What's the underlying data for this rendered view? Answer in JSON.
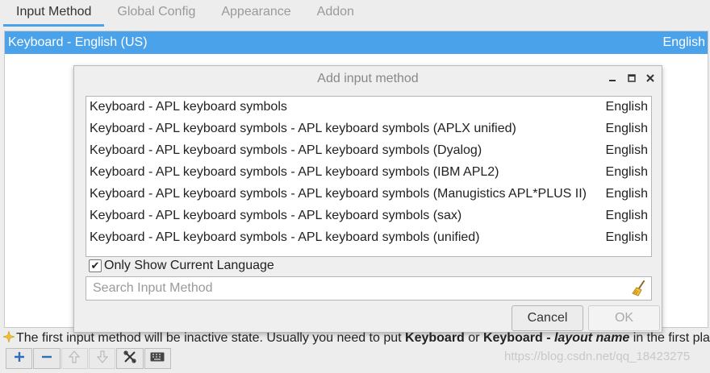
{
  "tabs": [
    {
      "label": "Input Method"
    },
    {
      "label": "Global Config"
    },
    {
      "label": "Appearance"
    },
    {
      "label": "Addon"
    }
  ],
  "main_list": {
    "selected": {
      "name": "Keyboard - English (US)",
      "language": "English"
    }
  },
  "dialog": {
    "title": "Add input method",
    "items": [
      {
        "name": "Keyboard - APL keyboard symbols",
        "language": "English"
      },
      {
        "name": "Keyboard - APL keyboard symbols - APL keyboard symbols (APLX unified)",
        "language": "English"
      },
      {
        "name": "Keyboard - APL keyboard symbols - APL keyboard symbols (Dyalog)",
        "language": "English"
      },
      {
        "name": "Keyboard - APL keyboard symbols - APL keyboard symbols (IBM APL2)",
        "language": "English"
      },
      {
        "name": "Keyboard - APL keyboard symbols - APL keyboard symbols (Manugistics APL*PLUS II)",
        "language": "English"
      },
      {
        "name": "Keyboard - APL keyboard symbols - APL keyboard symbols (sax)",
        "language": "English"
      },
      {
        "name": "Keyboard - APL keyboard symbols - APL keyboard symbols (unified)",
        "language": "English"
      }
    ],
    "only_current_language": {
      "label": "Only Show Current Language",
      "checked": true
    },
    "search": {
      "placeholder": "Search Input Method",
      "value": ""
    },
    "cancel_label": "Cancel",
    "ok_label": "OK"
  },
  "hint": {
    "part1": "The first input method will be inactive state. Usually you need to put ",
    "bold1": "Keyboard",
    "part2": " or ",
    "bold2": "Keyboard - ",
    "bold_italic": "layout name",
    "part3": " in the first place."
  },
  "toolbar": {
    "buttons": [
      "add-icon",
      "remove-icon",
      "move-up-icon",
      "move-down-icon",
      "configure-icon",
      "keyboard-icon"
    ]
  },
  "watermark": "https://blog.csdn.net/qq_18423275",
  "colors": {
    "accent": "#4aa3ea",
    "background": "#ededed"
  }
}
